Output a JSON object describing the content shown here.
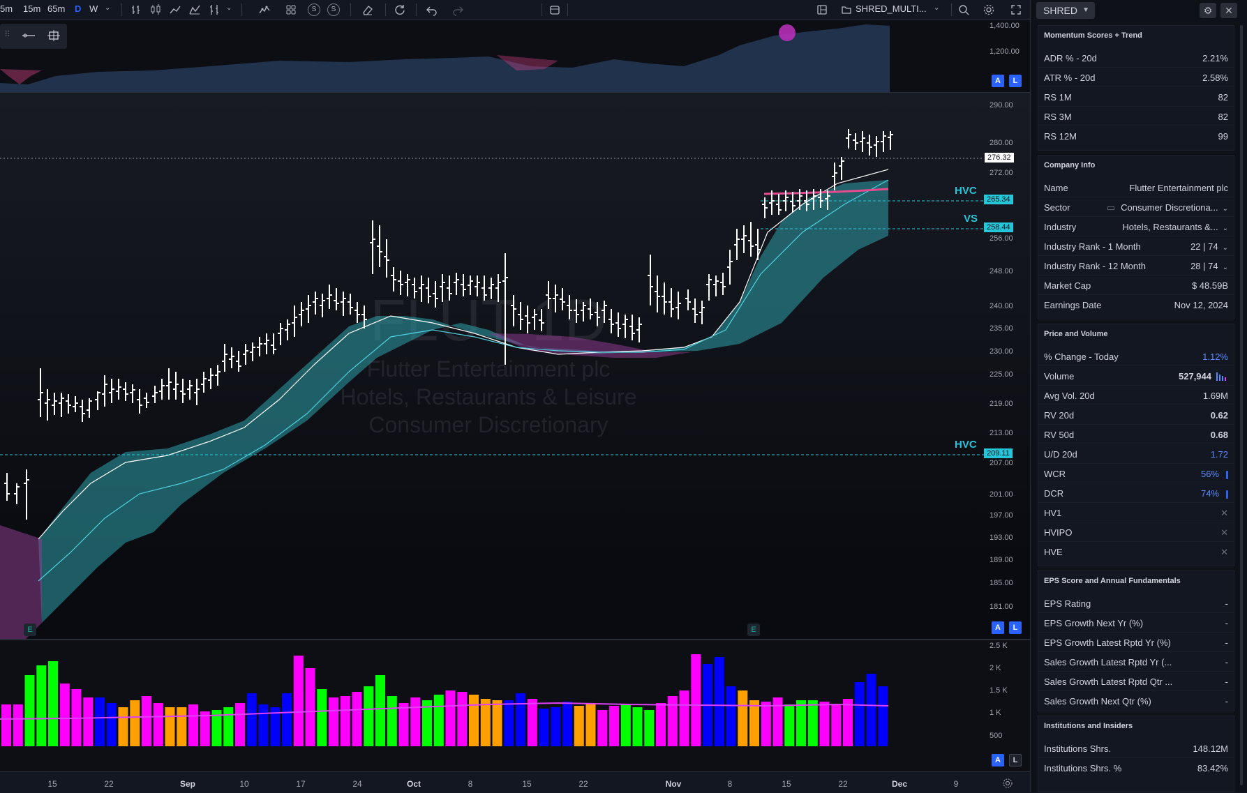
{
  "toolbar": {
    "timeframes": [
      "5m",
      "15m",
      "65m",
      "D",
      "W"
    ],
    "active_timeframe": "D",
    "s_buttons": [
      "S",
      "S"
    ],
    "layout_name": "SHRED_MULTI..."
  },
  "colors": {
    "accent": "#2962ff",
    "cyan": "#26c6da",
    "vol_green": "#00ff00",
    "vol_magenta": "#ff00ff",
    "vol_blue": "#0000ff",
    "vol_orange": "#ff9f00",
    "ma_pink": "#e84a8f"
  },
  "chart": {
    "watermark": {
      "symbol": "FLUT 1D",
      "name": "Flutter Entertainment plc",
      "industry": "Hotels, Restaurants & Leisure",
      "sector": "Consumer Discretionary"
    },
    "top_axis": [
      "1,400.00",
      "1,200.00"
    ],
    "price_axis": [
      "290.00",
      "280.00",
      "272.00",
      "256.00",
      "248.00",
      "240.00",
      "235.00",
      "230.00",
      "225.00",
      "219.00",
      "213.00",
      "207.00",
      "201.00",
      "197.00",
      "193.00",
      "189.00",
      "185.00",
      "181.00"
    ],
    "volume_axis": [
      "2.5 K",
      "2 K",
      "1.5 K",
      "1 K",
      "500"
    ],
    "time_axis": [
      "15",
      "22",
      "Sep",
      "10",
      "17",
      "24",
      "Oct",
      "8",
      "15",
      "22",
      "Nov",
      "8",
      "15",
      "22",
      "Dec",
      "9"
    ],
    "current_price": "276.32",
    "levels": [
      {
        "label": "HVC",
        "value": "265.34"
      },
      {
        "label": "VS",
        "value": "258.44"
      },
      {
        "label": "HVC",
        "value": "209.11"
      }
    ],
    "earnings_badge": "E",
    "al_buttons": [
      "A",
      "L"
    ]
  },
  "panel": {
    "symbol": "SHRED",
    "sections": [
      {
        "title": "Momentum Scores + Trend",
        "rows": [
          {
            "k": "ADR % - 20d",
            "v": "2.21%"
          },
          {
            "k": "ATR % - 20d",
            "v": "2.58%"
          },
          {
            "k": "RS 1M",
            "v": "82"
          },
          {
            "k": "RS 3M",
            "v": "82"
          },
          {
            "k": "RS 12M",
            "v": "99"
          }
        ]
      },
      {
        "title": "Company Info",
        "rows": [
          {
            "k": "Name",
            "v": "Flutter Entertainment plc"
          },
          {
            "k": "Sector",
            "v": "Consumer Discretiona..."
          },
          {
            "k": "Industry",
            "v": "Hotels, Restaurants &..."
          },
          {
            "k": "Industry Rank - 1 Month",
            "v": "22 | 74"
          },
          {
            "k": "Industry Rank - 12 Month",
            "v": "28 | 74"
          },
          {
            "k": "Market Cap",
            "v": "$ 48.59B"
          },
          {
            "k": "Earnings Date",
            "v": "Nov 12, 2024"
          }
        ]
      },
      {
        "title": "Price and Volume",
        "rows": [
          {
            "k": "% Change - Today",
            "v": "1.12%"
          },
          {
            "k": "Volume",
            "v": "527,944"
          },
          {
            "k": "Avg Vol. 20d",
            "v": "1.69M"
          },
          {
            "k": "RV 20d",
            "v": "0.62"
          },
          {
            "k": "RV 50d",
            "v": "0.68"
          },
          {
            "k": "U/D 20d",
            "v": "1.72"
          },
          {
            "k": "WCR",
            "v": "56%"
          },
          {
            "k": "DCR",
            "v": "74%"
          },
          {
            "k": "HV1",
            "v": "✕"
          },
          {
            "k": "HVIPO",
            "v": "✕"
          },
          {
            "k": "HVE",
            "v": "✕"
          }
        ]
      },
      {
        "title": "EPS Score and Annual Fundamentals",
        "rows": [
          {
            "k": "EPS Rating",
            "v": "-"
          },
          {
            "k": "EPS Growth Next Yr (%)",
            "v": "-"
          },
          {
            "k": "EPS Growth Latest Rptd Yr (%)",
            "v": "-"
          },
          {
            "k": "Sales Growth Latest Rptd Yr (...",
            "v": "-"
          },
          {
            "k": "Sales Growth Latest Rptd Qtr ...",
            "v": "-"
          },
          {
            "k": "Sales Growth Next Qtr (%)",
            "v": "-"
          }
        ]
      },
      {
        "title": "Institutions and Insiders",
        "rows": [
          {
            "k": "Institutions Shrs.",
            "v": "148.12M"
          },
          {
            "k": "Institutions Shrs. %",
            "v": "83.42%"
          }
        ]
      }
    ]
  }
}
